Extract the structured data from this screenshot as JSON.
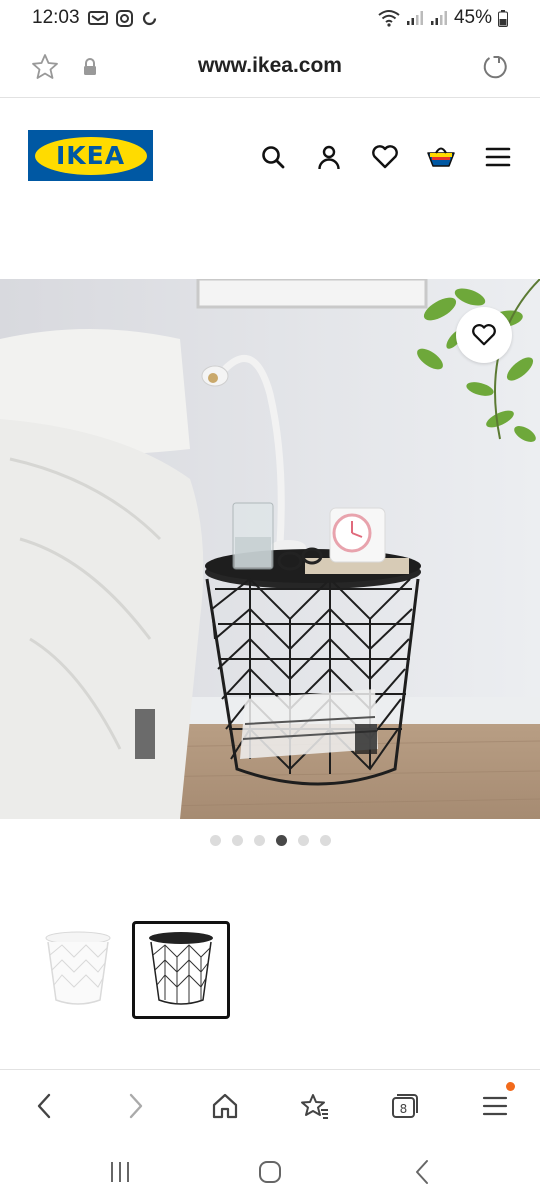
{
  "status_bar": {
    "time": "12:03",
    "battery": "45%",
    "left_icons": [
      "message-badge-icon",
      "instagram-icon",
      "sync-icon"
    ],
    "right_icons": [
      "wifi-icon",
      "signal-icon",
      "signal-icon",
      "battery-icon"
    ]
  },
  "browser": {
    "url": "www.ikea.com",
    "icons": [
      "star-icon",
      "lock-icon",
      "reload-icon"
    ]
  },
  "header": {
    "logo_text": "IKEA",
    "icons": [
      "search-icon",
      "account-icon",
      "heart-icon",
      "cart-icon",
      "menu-icon"
    ],
    "brand_blue": "#0058a3",
    "brand_yellow": "#ffdb00"
  },
  "gallery": {
    "slide_count": 6,
    "active_slide": 4,
    "favourite_icon": "heart-icon"
  },
  "variants": [
    {
      "color": "white",
      "selected": false
    },
    {
      "color": "black",
      "selected": true
    }
  ],
  "bottom_nav": {
    "tab_count": "8",
    "icons": [
      "back-icon",
      "forward-icon",
      "home-icon",
      "bookmarks-icon",
      "tabs-icon",
      "menu-icon"
    ],
    "accent": "#f26a1b"
  },
  "android_nav": {
    "icons": [
      "recents-icon",
      "home-icon",
      "back-icon"
    ]
  }
}
